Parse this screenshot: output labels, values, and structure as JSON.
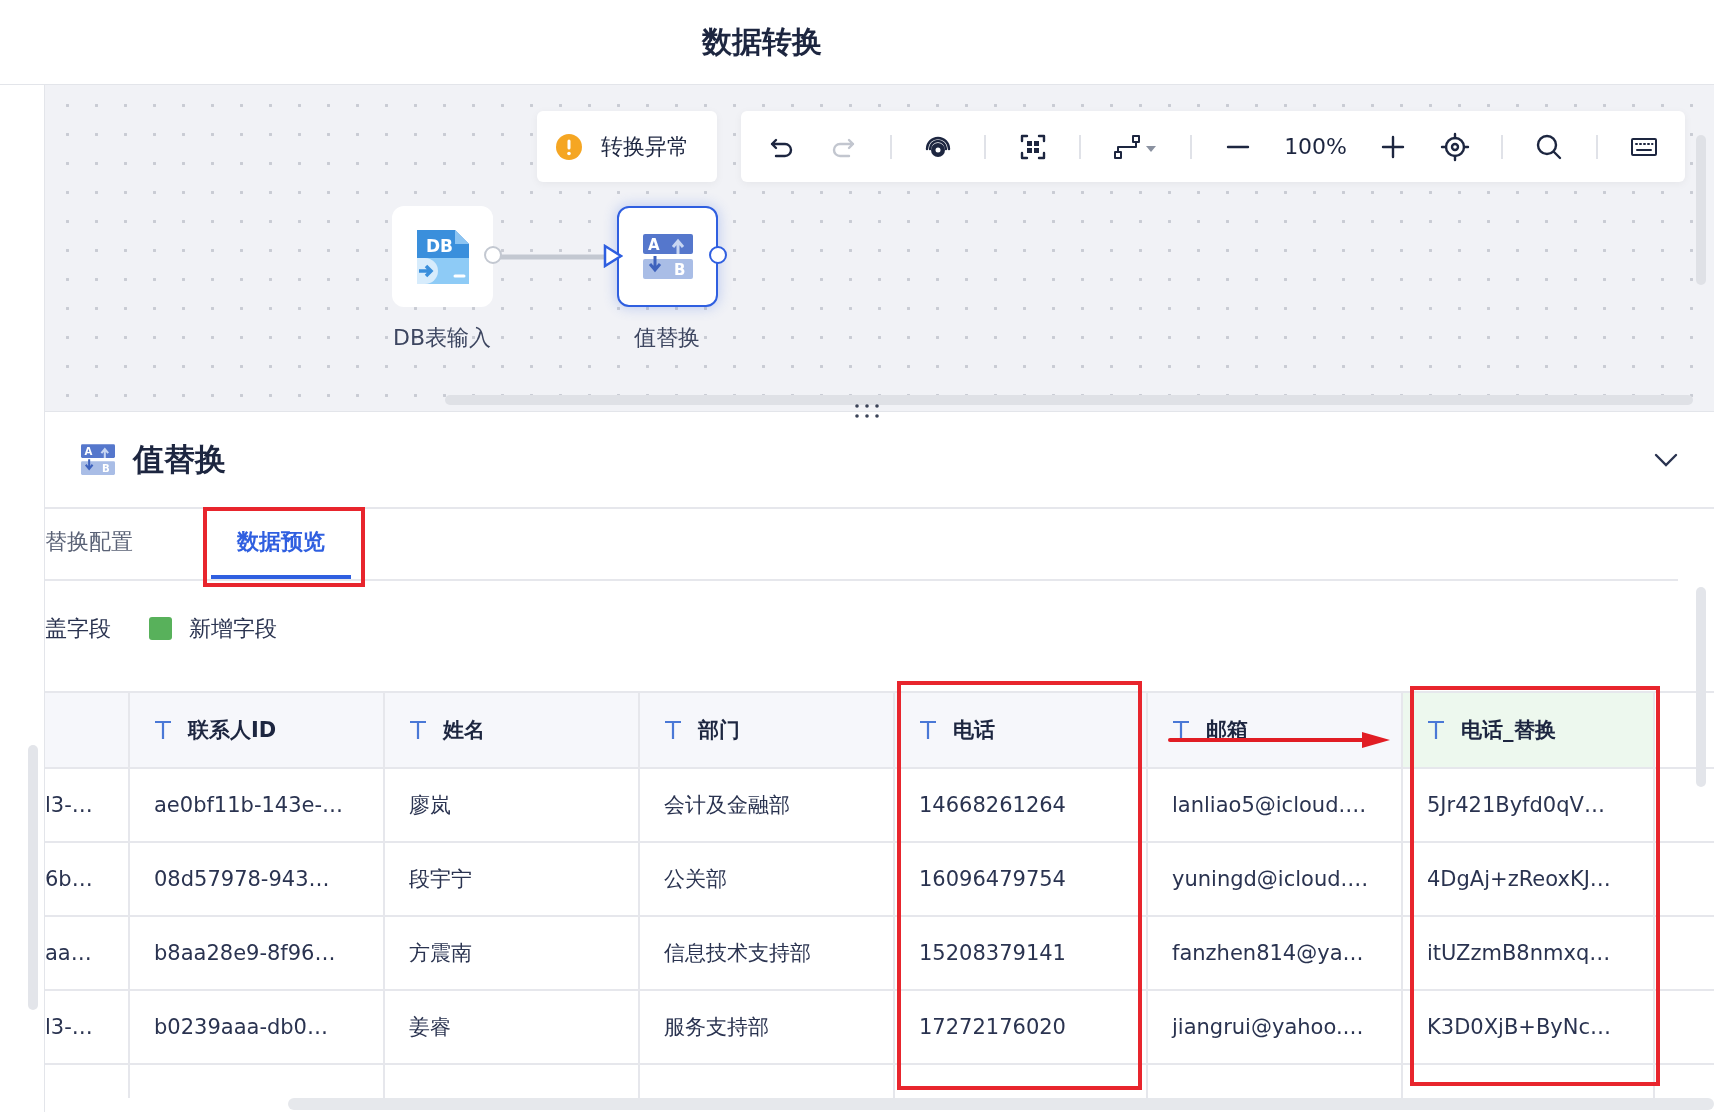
{
  "window": {
    "title": "数据转换"
  },
  "canvas": {
    "status": {
      "label": "转换异常",
      "kind": "warning"
    },
    "toolbar": [
      {
        "kind": "undo",
        "disabled": false
      },
      {
        "kind": "redo",
        "disabled": true
      },
      {
        "kind": "sep"
      },
      {
        "kind": "preview",
        "disabled": false
      },
      {
        "kind": "sep"
      },
      {
        "kind": "fit",
        "disabled": false
      },
      {
        "kind": "sep"
      },
      {
        "kind": "connector",
        "disabled": false
      },
      {
        "kind": "sep"
      },
      {
        "kind": "zoom-out",
        "disabled": false
      },
      {
        "kind": "zoom-level",
        "label": "100%"
      },
      {
        "kind": "zoom-in",
        "disabled": false
      },
      {
        "kind": "locate",
        "disabled": false
      },
      {
        "kind": "sep"
      },
      {
        "kind": "search",
        "disabled": false
      },
      {
        "kind": "sep"
      },
      {
        "kind": "keyboard",
        "disabled": false
      }
    ],
    "nodes": [
      {
        "label": "DB表输入",
        "kind": "db-input",
        "selected": false,
        "icon_text": [
          "DB"
        ]
      },
      {
        "label": "值替换",
        "kind": "value-replace",
        "selected": true,
        "icon_text": [
          "A",
          "B"
        ]
      }
    ]
  },
  "panel": {
    "title": "值替换",
    "icon_text": [
      "A",
      "B"
    ],
    "expanded": true,
    "tabs": [
      {
        "label": "替换配置",
        "selected": false
      },
      {
        "label": "数据预览",
        "selected": true
      }
    ],
    "legend": [
      {
        "label": "盖字段"
      },
      {
        "label": "新增字段",
        "color": "#58b15b"
      }
    ],
    "table": {
      "columns": [
        {
          "new": false
        },
        {
          "label": "联系人ID",
          "new": false
        },
        {
          "label": "姓名",
          "new": false
        },
        {
          "label": "部门",
          "new": false
        },
        {
          "label": "电话",
          "new": false
        },
        {
          "label": "邮箱",
          "new": false
        },
        {
          "label": "电话_替换",
          "new": true
        }
      ],
      "rows": [
        [
          "l3-…",
          "ae0bf11b-143e-…",
          "廖岚",
          "会计及金融部",
          "14668261264",
          "lanliao5@icloud.…",
          "5Jr421Byfd0qV…"
        ],
        [
          "6b…",
          "08d57978-943…",
          "段宇宁",
          "公关部",
          "16096479754",
          "yuningd@icloud.…",
          "4DgAj+zReoxKJ…"
        ],
        [
          "aa…",
          "b8aa28e9-8f96…",
          "方震南",
          "信息技术支持部",
          "15208379141",
          "fanzhen814@ya…",
          "itUZzmB8nmxq…"
        ],
        [
          "l3-…",
          "b0239aaa-db0…",
          "姜睿",
          "服务支持部",
          "17272176020",
          "jiangrui@yahoo.…",
          "K3D0XjB+ByNc…"
        ]
      ]
    }
  }
}
